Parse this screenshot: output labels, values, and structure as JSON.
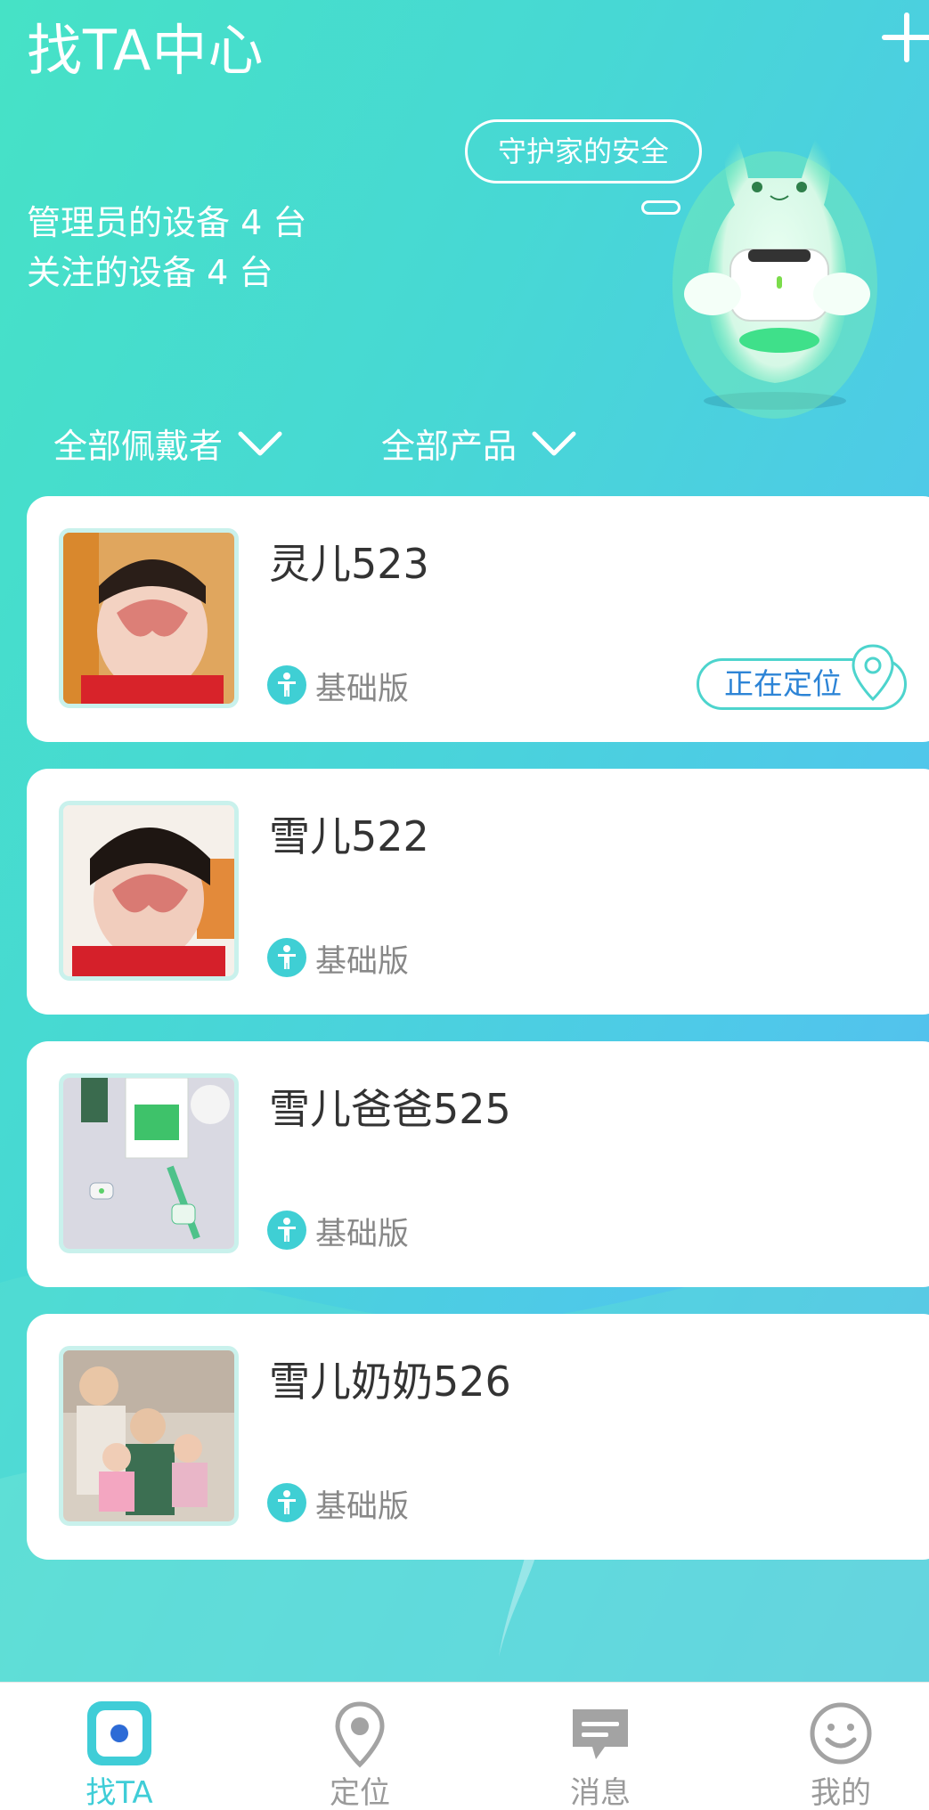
{
  "header": {
    "title": "找TA中心",
    "admin_devices": "管理员的设备 4 台",
    "followed_devices": "关注的设备 4 台",
    "slogan": "守护家的安全"
  },
  "filters": {
    "wearer": "全部佩戴者",
    "product": "全部产品"
  },
  "devices": [
    {
      "name": "灵儿523",
      "edition": "基础版",
      "status": "正在定位"
    },
    {
      "name": "雪儿522",
      "edition": "基础版",
      "status": ""
    },
    {
      "name": "雪儿爸爸525",
      "edition": "基础版",
      "status": ""
    },
    {
      "name": "雪儿奶奶526",
      "edition": "基础版",
      "status": ""
    }
  ],
  "tabbar": {
    "items": [
      {
        "label": "找TA"
      },
      {
        "label": "定位"
      },
      {
        "label": "消息"
      },
      {
        "label": "我的"
      }
    ]
  },
  "colors": {
    "accent": "#3fcdd7",
    "status_text": "#2d84d6",
    "tab_inactive": "#9a9a9a"
  }
}
